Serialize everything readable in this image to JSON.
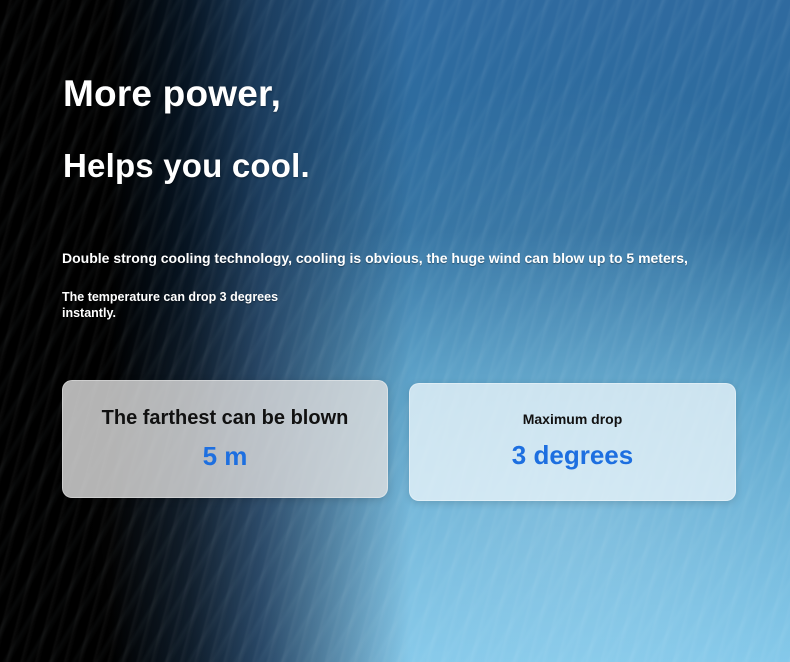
{
  "hero": {
    "title_line1": "More power,",
    "title_line2": "Helps you cool.",
    "description_line1": "Double strong cooling technology, cooling is obvious, the huge wind can blow up to 5 meters,",
    "description_line2": "The temperature can drop 3 degrees instantly."
  },
  "stats": [
    {
      "label": "The farthest can be blown",
      "value": "5 m"
    },
    {
      "label": "Maximum drop",
      "value": "3 degrees"
    }
  ],
  "colors": {
    "accent_blue": "#1d6fe0",
    "background_dark": "#000000",
    "background_blue": "#2c6e9f",
    "card_left_bg": "#e1e1e1",
    "card_right_bg": "#ebf5fa"
  }
}
